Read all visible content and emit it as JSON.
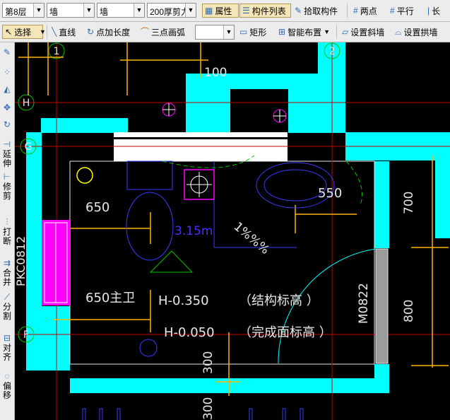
{
  "toolbar1": {
    "floor": "第8层",
    "category": "墙",
    "type": "墙",
    "component": "200厚剪力",
    "properties": "属性",
    "component_list": "构件列表",
    "pick_component": "拾取构件",
    "two_points": "两点",
    "parallel": "平行",
    "cut_label": "长"
  },
  "toolbar2": {
    "select": "选择",
    "line": "直线",
    "point_length": "点加长度",
    "arc3": "三点画弧",
    "arc_value": "",
    "rect": "矩形",
    "smart_layout": "智能布置",
    "slope_wall": "设置斜墙",
    "arch_wall": "设置拱墙"
  },
  "sidebar": [
    {
      "icon": "brush-icon",
      "label": ""
    },
    {
      "icon": "move-icon",
      "label": ""
    },
    {
      "icon": "mirror-icon",
      "label": ""
    },
    {
      "icon": "pan-icon",
      "label": ""
    },
    {
      "icon": "rotate-icon",
      "label": ""
    },
    {
      "icon": "extend-icon",
      "label": "延伸"
    },
    {
      "icon": "trim-icon",
      "label": "修剪"
    },
    {
      "icon": "break-icon",
      "label": "打断"
    },
    {
      "icon": "merge-icon",
      "label": "合并"
    },
    {
      "icon": "split-icon",
      "label": "分割"
    },
    {
      "icon": "align-icon",
      "label": "对齐"
    },
    {
      "icon": "offset-icon",
      "label": "偏移"
    }
  ],
  "drawing": {
    "axis_1": "1",
    "axis_2": "2",
    "axis_H": "H",
    "axis_G": "G",
    "axis_F": "F",
    "dim_100": "100",
    "dim_650_top": "650",
    "dim_550": "550",
    "dim_700": "700",
    "dim_800": "800",
    "dim_300": "300",
    "dim_300b": "300",
    "span": "3.15m",
    "slope": "1%%%",
    "room": "650主卫",
    "elev_struct_value": "H-0.350",
    "elev_struct_label": "（结构标高   ）",
    "elev_finish_value": "H-0.050",
    "elev_finish_label": "（完成面标高    ）",
    "door": "M0822",
    "window": "PKC0812"
  },
  "colors": {
    "cad_bg": "#000000",
    "wall": "#00ffff",
    "dim": "#ffb300",
    "axis": "#c00000",
    "text": "#e8e8e8",
    "fixture": "#3a3aff",
    "accent_magenta": "#ff00ff"
  }
}
